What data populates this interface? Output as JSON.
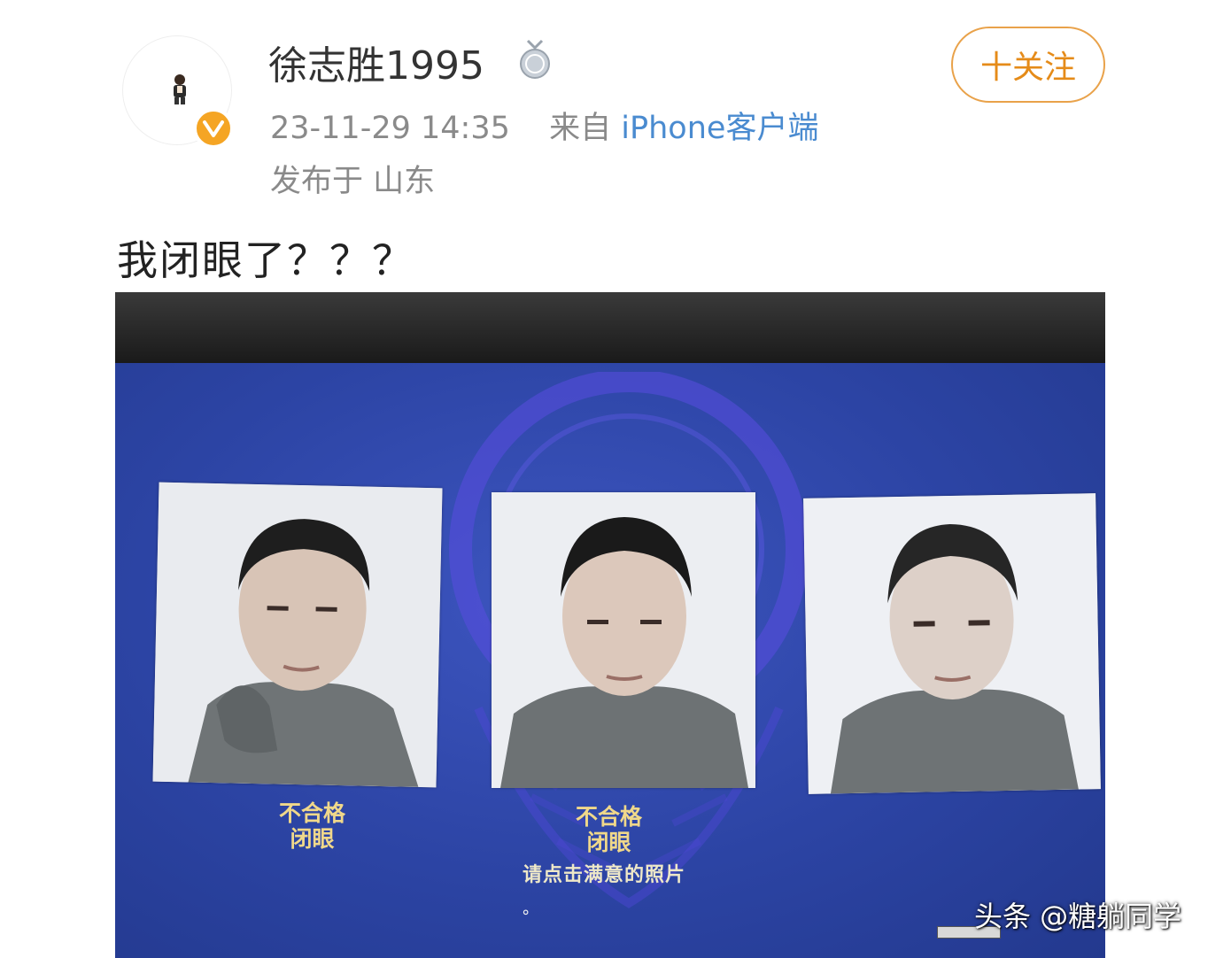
{
  "post": {
    "username": "徐志胜1995",
    "timestamp": "23-11-29 14:35",
    "source_prefix": "来自",
    "source": "iPhone客户端",
    "location": "发布于 山东",
    "follow_label": "十关注",
    "text": "我闭眼了？？？",
    "avatar_icon": "avatar-figure-icon",
    "verified_icon": "verified-v-icon",
    "medal_icon": "medal-icon",
    "accent_color": "#e58b19",
    "verified_color": "#f5a524"
  },
  "photo": {
    "cards": [
      {
        "status": "不合格",
        "reason": "闭眼"
      },
      {
        "status": "不合格",
        "reason": "闭眼"
      },
      {
        "status": "",
        "reason": ""
      }
    ],
    "hint": "请点击满意的照片",
    "screen_color": "#2c44a4",
    "label_color": "#f0d88a"
  },
  "watermark": "头条 @糖躺同学"
}
